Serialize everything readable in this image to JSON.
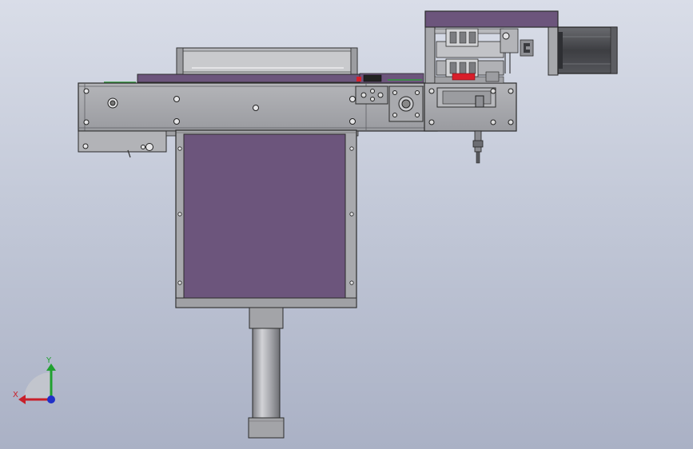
{
  "viewport": {
    "background_top": "#d9dde8",
    "background_bottom": "#aab1c5"
  },
  "colors": {
    "purple_panel": "#6c557c",
    "purple_plate": "#74608a",
    "steel": "#a7a8ac",
    "steel_dark": "#7d7e83",
    "steel_light": "#c8c9cd",
    "outline": "#2b2b2b",
    "motor_dark": "#4a4b4f",
    "accent_red": "#d81e2a",
    "accent_green": "#2f9b3a"
  },
  "triad": {
    "x_axis_label": "X",
    "y_axis_label": "Y",
    "x_axis_color": "#c8202a",
    "y_axis_color": "#20a030",
    "z_axis_color": "#2030c8",
    "icon": "coordinate-triad-icon"
  }
}
